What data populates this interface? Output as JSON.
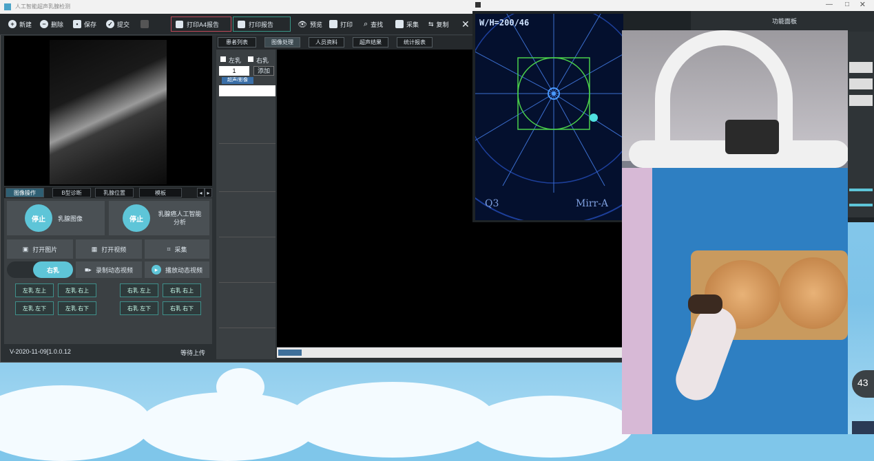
{
  "window": {
    "title": "人工智能超声乳腺检测"
  },
  "toolbar": {
    "new": "新建",
    "delete": "删除",
    "save": "保存",
    "submit": "提交",
    "print_a4": "打印A4报告",
    "print_report": "打印报告",
    "preview": "预览",
    "print": "打印",
    "search": "查找",
    "collect": "采集",
    "copy": "复制"
  },
  "left_tabs": [
    "图像操作",
    "B型诊断",
    "乳腺位置",
    "模板"
  ],
  "controls": {
    "stop_label": "停止",
    "freeze_label": "乳腺图像",
    "ai_label": "乳腺癌人工智能分析",
    "open_image": "打开图片",
    "open_video": "打开视频",
    "capture": "采集",
    "side_toggle": "右乳",
    "record": "录制动态视频",
    "play": "播放动态视频",
    "left_grid": [
      [
        "左乳 左上",
        "左乳 右上"
      ],
      [
        "左乳 左下",
        "左乳 右下"
      ]
    ],
    "right_grid": [
      [
        "右乳 左上",
        "右乳 右上"
      ],
      [
        "右乳 左下",
        "右乳 右下"
      ]
    ]
  },
  "status": {
    "version": "V-2020-11-09[1.0.0.12",
    "upload": "等待上传"
  },
  "middle_tabs": [
    "患者列表",
    "图像处理",
    "人员资料",
    "超声结果",
    "统计报表"
  ],
  "list": {
    "left_check": "左乳",
    "right_check": "右乳",
    "count": "1",
    "btn": "添加",
    "sub": "超声/影像"
  },
  "overlay": {
    "readout": "W/H=200/46",
    "q3": "Q3",
    "mirror": "Mirr-A",
    "panel_title": "功能面板"
  },
  "taskbar": {
    "clock_value": "43"
  },
  "colors": {
    "accent": "#5ec5d8",
    "grid_border": "#3f8f8a"
  }
}
